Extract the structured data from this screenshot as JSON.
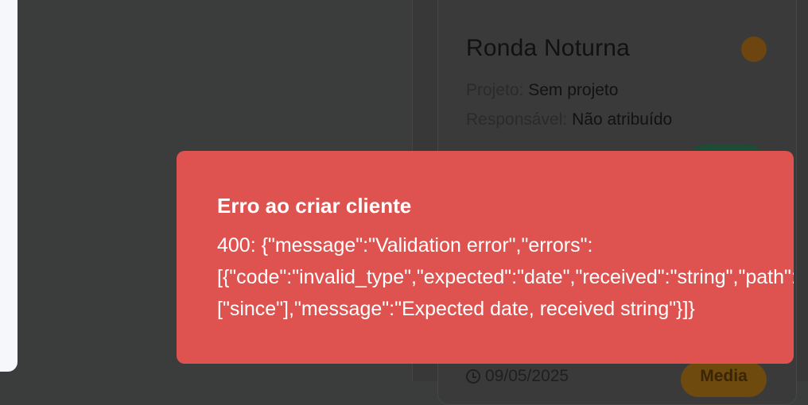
{
  "card": {
    "title": "Ronda Noturna",
    "project_label": "Projeto:",
    "project_value": "Sem projeto",
    "assignee_label": "Responsável:",
    "assignee_value": "Não atribuído",
    "date": "09/05/2025",
    "priority": "Media",
    "status_color": "#6d4510"
  },
  "toast": {
    "title": "Erro ao criar cliente",
    "message_lines": [
      "400: {\"message\":\"Validation error\",\"errors\":",
      "[{\"code\":\"invalid_type\",\"expected\":\"date\",\"received\":\"string\",\"path\":",
      "[\"since\"],\"message\":\"Expected date, received string\"}]}"
    ],
    "color": "#de534f"
  },
  "icons": {
    "date": "clock-icon"
  }
}
